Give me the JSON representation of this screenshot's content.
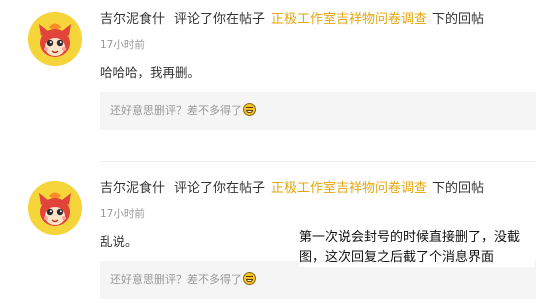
{
  "notifications": [
    {
      "user": "吉尔泥食什",
      "action": "评论了你在帖子",
      "topic": "正极工作室吉祥物问卷调查",
      "suffix": "下的回帖",
      "time": "17小时前",
      "content": "哈哈哈，我再删。",
      "quote": "还好意思删评？差不多得了",
      "quote_emoji": "grinning-sweat-emoji"
    },
    {
      "user": "吉尔泥食什",
      "action": "评论了你在帖子",
      "topic": "正极工作室吉祥物问卷调查",
      "suffix": "下的回帖",
      "time": "17小时前",
      "content": "乱说。",
      "quote": "还好意思删评？差不多得了",
      "quote_emoji": "grinning-sweat-emoji"
    }
  ],
  "overlay_caption": "第一次说会封号的时候直接删了，没截图，这次回复之后截了个消息界面",
  "colors": {
    "topic_link": "#e5a50d",
    "avatar_bg": "#f6d53a",
    "quote_bg": "#f5f5f5",
    "muted_text": "#999999"
  }
}
